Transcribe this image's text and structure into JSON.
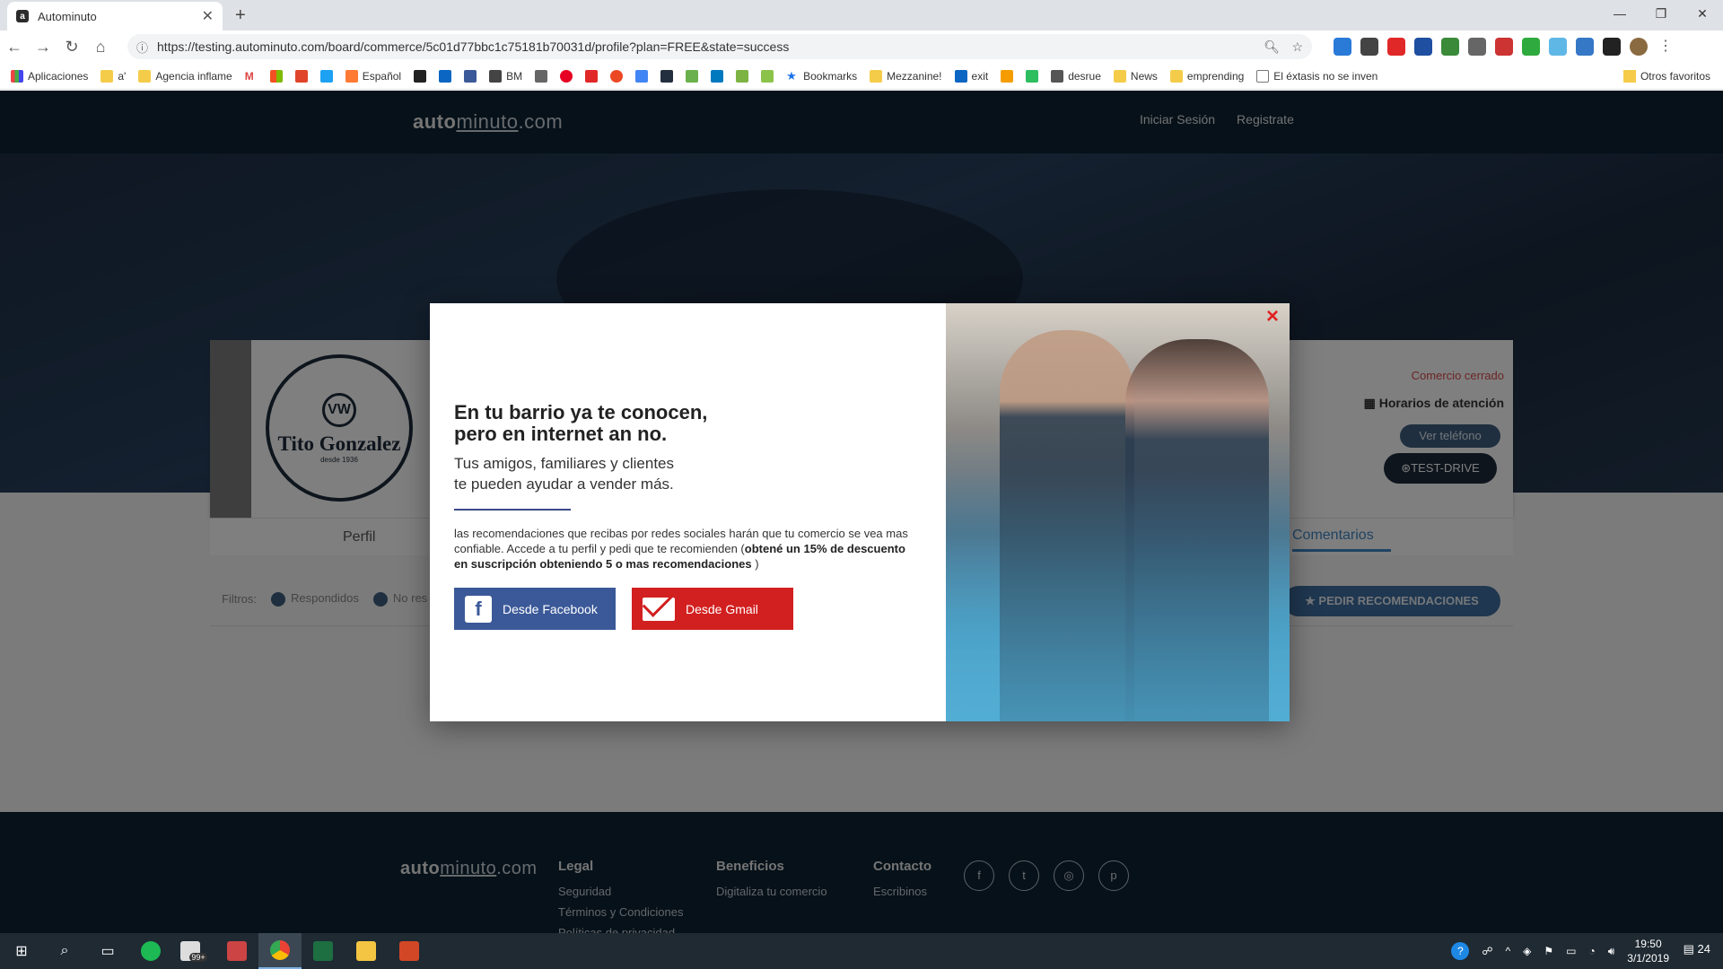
{
  "browser": {
    "tab_title": "Autominuto",
    "url": "https://testing.autominuto.com/board/commerce/5c01d77bbc1c75181b70031d/profile?plan=FREE&state=success",
    "bookmarks": [
      "Aplicaciones",
      "a'",
      "Agencia inflame",
      "Español",
      "BM",
      "Bookmarks",
      "Mezzanine!",
      "exit",
      "desrue",
      "News",
      "emprending",
      "El éxtasis no se inven"
    ],
    "otros_favoritos": "Otros favoritos"
  },
  "site": {
    "logo_bold": "auto",
    "logo_thin": "minuto",
    "logo_tld": ".com",
    "nav": {
      "login": "Iniciar Sesión",
      "register": "Registrate"
    }
  },
  "commerce": {
    "logo_name": "Tito Gonzalez",
    "logo_since": "desde 1936",
    "logo_badge": "VW",
    "status": "Comercio cerrado",
    "hours_label": "Horarios de atención",
    "phone_button": "Ver teléfono",
    "test_drive_button": "TEST-DRIVE",
    "tabs": {
      "profile": "Perfil",
      "comments": "Comentarios"
    },
    "filters": {
      "label": "Filtros:",
      "answered": "Respondidos",
      "unanswered": "No res"
    },
    "recommend_button": "PEDIR RECOMENDACIONES"
  },
  "modal": {
    "title_line1": "En tu barrio ya te conocen,",
    "title_line2": "pero en internet an no.",
    "sub_line1": "Tus amigos, familiares y clientes",
    "sub_line2": "te pueden ayudar a vender más.",
    "body_plain": "las recomendaciones que recibas por redes sociales harán que tu comercio se vea mas confiable. Accede a tu perfil y pedi que te recomienden (",
    "body_bold": "obtené un 15% de descuento en suscripción obteniendo 5 o mas recomendaciones",
    "body_close": " )",
    "facebook_button": "Desde Facebook",
    "gmail_button": "Desde Gmail",
    "close": "×"
  },
  "footer": {
    "legal": {
      "title": "Legal",
      "items": [
        "Seguridad",
        "Términos y Condiciones",
        "Políticas de privacidad"
      ]
    },
    "beneficios": {
      "title": "Beneficios",
      "items": [
        "Digitaliza tu comercio"
      ]
    },
    "contacto": {
      "title": "Contacto",
      "items": [
        "Escribinos"
      ]
    }
  },
  "taskbar": {
    "time": "19:50",
    "date": "3/1/2019",
    "notifications": "24",
    "mail_badge": "99+"
  },
  "colors": {
    "header": "#0d2233",
    "facebook": "#3b5998",
    "gmail": "#d21f1f",
    "accent": "#3e86c6"
  }
}
